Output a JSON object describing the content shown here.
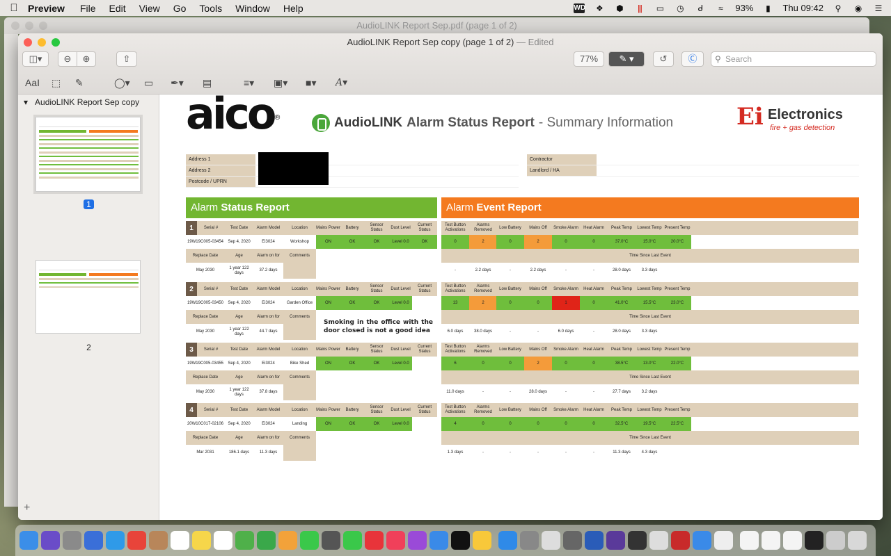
{
  "menubar": {
    "app": "Preview",
    "items": [
      "File",
      "Edit",
      "View",
      "Go",
      "Tools",
      "Window",
      "Help"
    ],
    "battery": "93%",
    "clock": "Thu 09:42"
  },
  "background_window": {
    "title": "AudioLINK Report Sep.pdf (page 1 of 2)"
  },
  "window": {
    "title": "AudioLINK Report Sep copy (page 1 of 2)",
    "edited": "— Edited",
    "zoom": "77%",
    "search_placeholder": "Search"
  },
  "sidebar": {
    "doc_name": "AudioLINK Report Sep copy",
    "pages": [
      "1",
      "2"
    ]
  },
  "report": {
    "brand": "aico",
    "audiolink": "AudioLINK",
    "title_bold": "Alarm Status Report",
    "title_rest": "- Summary Information",
    "ei_mark": "Ei",
    "ei_name": "Electronics",
    "ei_tag": "fire + gas detection",
    "address_labels": [
      "Address 1",
      "Address 2",
      "Postcode / UPRN"
    ],
    "contractor_labels": [
      "Contractor",
      "Landlord / HA"
    ],
    "status_heading_light": "Alarm ",
    "status_heading_bold": "Status Report",
    "event_heading_light": "Alarm ",
    "event_heading_bold": "Event Report",
    "status_headers": [
      "Serial #",
      "Test Date",
      "Alarm Model",
      "Location",
      "Mains Power",
      "Battery",
      "Sensor Status",
      "Dust Level",
      "Current Status"
    ],
    "status_sub_headers": [
      "Replace Date",
      "Age",
      "Alarm on for",
      "Comments"
    ],
    "event_headers": [
      "Test Button Activations",
      "Alarms Removed",
      "Low Battery",
      "Mains Off",
      "Smoke Alarm",
      "Heat Alarm",
      "Peak Temp",
      "Lowest Temp",
      "Present Temp"
    ],
    "time_since": "Time Since Last Event",
    "alarms": [
      {
        "num": "1",
        "serial": "19W19C005-03454",
        "test_date": "Sep 4, 2020",
        "model": "Ei3024",
        "location": "Workshop",
        "mains": "ON",
        "battery": "OK",
        "sensor": "OK",
        "dust": "Level 0.0",
        "current": "OK",
        "replace": "May 2030",
        "age": "1 year 122 days",
        "on_for": "37.2 days",
        "comment": "",
        "events": [
          "0",
          "2",
          "0",
          "2",
          "0",
          "0",
          "37.0°C",
          "15.0°C",
          "20.0°C"
        ],
        "event_colors": [
          "g",
          "o",
          "g",
          "o",
          "g",
          "g",
          "g",
          "g",
          "g"
        ],
        "since": [
          "-",
          "2.2 days",
          "-",
          "2.2 days",
          "-",
          "-",
          "28.0 days",
          "3.3 days",
          ""
        ]
      },
      {
        "num": "2",
        "serial": "19W19C005-03450",
        "test_date": "Sep 4, 2020",
        "model": "Ei3024",
        "location": "Garden Office",
        "mains": "ON",
        "battery": "OK",
        "sensor": "OK",
        "dust": "Level 0.0",
        "current": "",
        "replace": "May 2030",
        "age": "1 year 122 days",
        "on_for": "44.7 days",
        "comment": "Smoking in the office with the door closed is not a good idea",
        "events": [
          "13",
          "2",
          "0",
          "0",
          "1",
          "0",
          "41.0°C",
          "15.5°C",
          "23.0°C"
        ],
        "event_colors": [
          "g",
          "o",
          "g",
          "g",
          "r",
          "g",
          "g",
          "g",
          "g"
        ],
        "since": [
          "6.0 days",
          "38.0 days",
          "-",
          "-",
          "6.0 days",
          "-",
          "28.0 days",
          "3.3 days",
          ""
        ]
      },
      {
        "num": "3",
        "serial": "19W19C005-03455",
        "test_date": "Sep 4, 2020",
        "model": "Ei3024",
        "location": "Bike Shed",
        "mains": "ON",
        "battery": "OK",
        "sensor": "OK",
        "dust": "Level 0.0",
        "current": "",
        "replace": "May 2030",
        "age": "1 year 122 days",
        "on_for": "37.8 days",
        "comment": "",
        "events": [
          "6",
          "0",
          "0",
          "2",
          "0",
          "0",
          "38.5°C",
          "13.0°C",
          "22.0°C"
        ],
        "event_colors": [
          "g",
          "g",
          "g",
          "o",
          "g",
          "g",
          "g",
          "g",
          "g"
        ],
        "since": [
          "11.0 days",
          "-",
          "-",
          "28.0 days",
          "-",
          "-",
          "27.7 days",
          "3.2 days",
          ""
        ]
      },
      {
        "num": "4",
        "serial": "20W10C017-02106",
        "test_date": "Sep 4, 2020",
        "model": "Ei3024",
        "location": "Landing",
        "mains": "ON",
        "battery": "OK",
        "sensor": "OK",
        "dust": "Level 0.0",
        "current": "",
        "replace": "Mar 2031",
        "age": "186.1 days",
        "on_for": "11.3 days",
        "comment": "",
        "events": [
          "4",
          "0",
          "0",
          "0",
          "0",
          "0",
          "32.5°C",
          "19.5°C",
          "22.5°C"
        ],
        "event_colors": [
          "g",
          "g",
          "g",
          "g",
          "g",
          "g",
          "g",
          "g",
          "g"
        ],
        "since": [
          "1.3 days",
          "-",
          "-",
          "-",
          "-",
          "-",
          "11.3 days",
          "4.3 days",
          ""
        ]
      }
    ]
  },
  "colors": {
    "green": "#6fbe3c",
    "orange": "#f49b3a",
    "red": "#e02418",
    "tan": "#dfd0b9",
    "status_bar": "#72b631",
    "event_bar": "#f47a1f"
  }
}
